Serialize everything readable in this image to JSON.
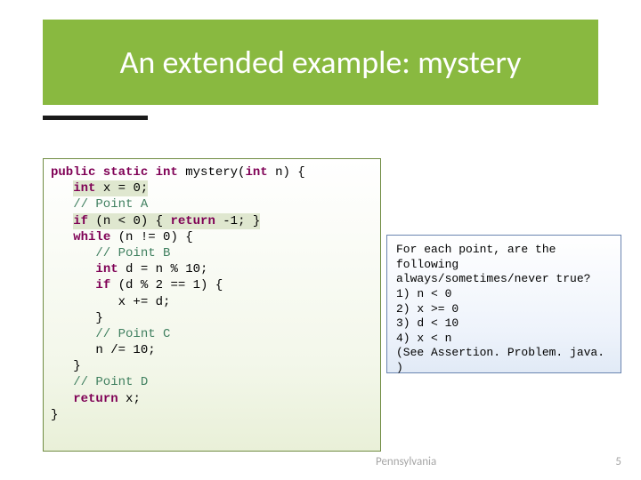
{
  "title": "An extended example: mystery",
  "code": {
    "sig_pre": "public static int ",
    "sig_name": "mystery(",
    "sig_post": " n) {",
    "l2_pre": "   ",
    "l2_decl": "int",
    "l2_rest": " x = 0;",
    "l3": "   // Point A",
    "l4_pre": "   ",
    "l4_if": "if",
    "l4_cond": " (n < 0) { ",
    "l4_ret": "return",
    "l4_tail": " -1; }",
    "l5_pre": "   ",
    "l5_w": "while",
    "l5_rest": " (n != 0) {",
    "l6": "      // Point B",
    "l7_pre": "      ",
    "l7_decl": "int",
    "l7_rest": " d = n % 10;",
    "l8_pre": "      ",
    "l8_if": "if",
    "l8_rest": " (d % 2 == 1) {",
    "l9": "         x += d;",
    "l10": "      }",
    "l11": "      // Point C",
    "l12": "      n /= 10;",
    "l13": "   }",
    "l14": "   // Point D",
    "l15_pre": "   ",
    "l15_ret": "return",
    "l15_rest": " x;",
    "l16": "}"
  },
  "question": {
    "q1": "For each point, are the",
    "q2": "following",
    "q3": "always/sometimes/never true?",
    "i1": "1) n < 0",
    "i2": "2) x >= 0",
    "i3": "3) d < 10",
    "i4": "4) x < n",
    "note": "(See Assertion. Problem. java. )"
  },
  "footer": {
    "univ": "Pennsylvania",
    "page": "5"
  }
}
